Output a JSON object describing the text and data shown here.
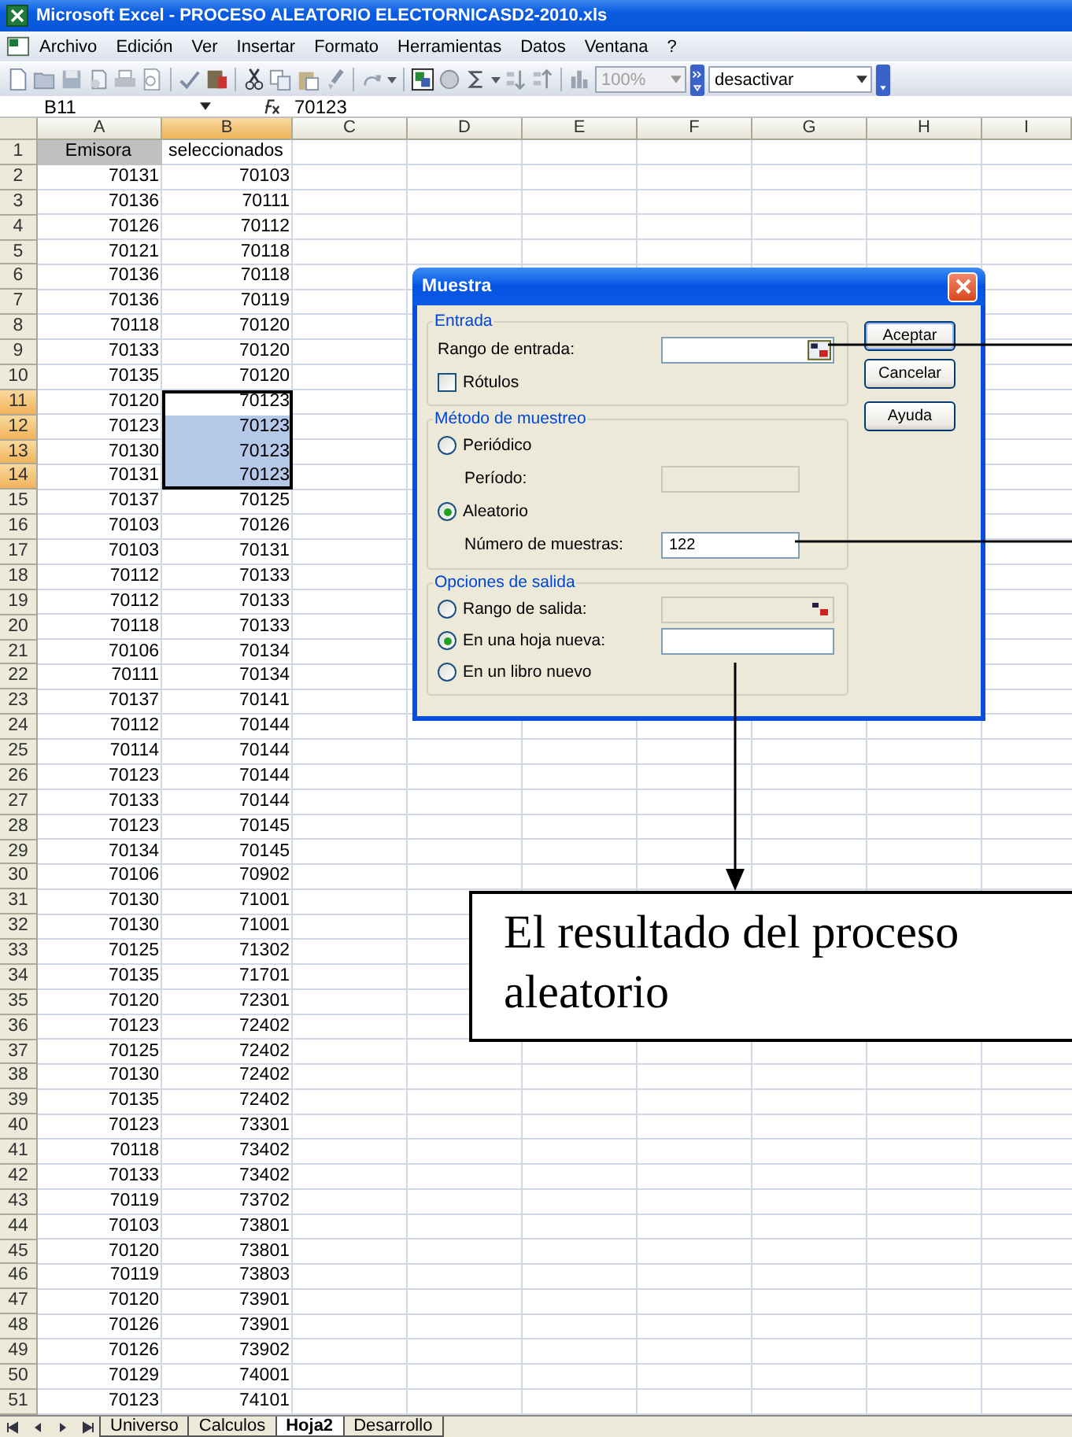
{
  "window": {
    "title": "Microsoft Excel - PROCESO ALEATORIO ELECTORNICASD2-2010.xls"
  },
  "menu_bar": [
    "Archivo",
    "Edición",
    "Ver",
    "Insertar",
    "Formato",
    "Herramientas",
    "Datos",
    "Ventana",
    "?"
  ],
  "toolbar": {
    "zoom": "100%",
    "style": "desactivar"
  },
  "formula_bar": {
    "name_box": "B11",
    "value": "70123"
  },
  "columns": [
    {
      "label": "A",
      "selected": false
    },
    {
      "label": "B",
      "selected": true
    },
    {
      "label": "C",
      "selected": false
    },
    {
      "label": "D",
      "selected": false
    },
    {
      "label": "E",
      "selected": false
    },
    {
      "label": "F",
      "selected": false
    },
    {
      "label": "G",
      "selected": false
    },
    {
      "label": "H",
      "selected": false
    },
    {
      "label": "I",
      "selected": false
    }
  ],
  "rows": [
    {
      "number": "1",
      "kind": "header",
      "selected": false,
      "active": false,
      "cells": [
        "Emisora",
        "seleccionados"
      ]
    },
    {
      "number": "2",
      "kind": "data",
      "selected": false,
      "active": false,
      "cells": [
        "70131",
        "70103"
      ]
    },
    {
      "number": "3",
      "kind": "data",
      "selected": false,
      "active": false,
      "cells": [
        "70136",
        "70111"
      ]
    },
    {
      "number": "4",
      "kind": "data",
      "selected": false,
      "active": false,
      "cells": [
        "70126",
        "70112"
      ]
    },
    {
      "number": "5",
      "kind": "data",
      "selected": false,
      "active": false,
      "cells": [
        "70121",
        "70118"
      ]
    },
    {
      "number": "6",
      "kind": "data",
      "selected": false,
      "active": false,
      "cells": [
        "70136",
        "70118"
      ]
    },
    {
      "number": "7",
      "kind": "data",
      "selected": false,
      "active": false,
      "cells": [
        "70136",
        "70119"
      ]
    },
    {
      "number": "8",
      "kind": "data",
      "selected": false,
      "active": false,
      "cells": [
        "70118",
        "70120"
      ]
    },
    {
      "number": "9",
      "kind": "data",
      "selected": false,
      "active": false,
      "cells": [
        "70133",
        "70120"
      ]
    },
    {
      "number": "10",
      "kind": "data",
      "selected": false,
      "active": false,
      "cells": [
        "70135",
        "70120"
      ]
    },
    {
      "number": "11",
      "kind": "data",
      "selected": true,
      "active": true,
      "cells": [
        "70120",
        "70123"
      ]
    },
    {
      "number": "12",
      "kind": "data",
      "selected": true,
      "active": false,
      "cells": [
        "70123",
        "70123"
      ]
    },
    {
      "number": "13",
      "kind": "data",
      "selected": true,
      "active": false,
      "cells": [
        "70130",
        "70123"
      ]
    },
    {
      "number": "14",
      "kind": "data",
      "selected": true,
      "active": false,
      "cells": [
        "70131",
        "70123"
      ]
    },
    {
      "number": "15",
      "kind": "data",
      "selected": false,
      "active": false,
      "cells": [
        "70137",
        "70125"
      ]
    },
    {
      "number": "16",
      "kind": "data",
      "selected": false,
      "active": false,
      "cells": [
        "70103",
        "70126"
      ]
    },
    {
      "number": "17",
      "kind": "data",
      "selected": false,
      "active": false,
      "cells": [
        "70103",
        "70131"
      ]
    },
    {
      "number": "18",
      "kind": "data",
      "selected": false,
      "active": false,
      "cells": [
        "70112",
        "70133"
      ]
    },
    {
      "number": "19",
      "kind": "data",
      "selected": false,
      "active": false,
      "cells": [
        "70112",
        "70133"
      ]
    },
    {
      "number": "20",
      "kind": "data",
      "selected": false,
      "active": false,
      "cells": [
        "70118",
        "70133"
      ]
    },
    {
      "number": "21",
      "kind": "data",
      "selected": false,
      "active": false,
      "cells": [
        "70106",
        "70134"
      ]
    },
    {
      "number": "22",
      "kind": "data",
      "selected": false,
      "active": false,
      "cells": [
        "70111",
        "70134"
      ]
    },
    {
      "number": "23",
      "kind": "data",
      "selected": false,
      "active": false,
      "cells": [
        "70137",
        "70141"
      ]
    },
    {
      "number": "24",
      "kind": "data",
      "selected": false,
      "active": false,
      "cells": [
        "70112",
        "70144"
      ]
    },
    {
      "number": "25",
      "kind": "data",
      "selected": false,
      "active": false,
      "cells": [
        "70114",
        "70144"
      ]
    },
    {
      "number": "26",
      "kind": "data",
      "selected": false,
      "active": false,
      "cells": [
        "70123",
        "70144"
      ]
    },
    {
      "number": "27",
      "kind": "data",
      "selected": false,
      "active": false,
      "cells": [
        "70133",
        "70144"
      ]
    },
    {
      "number": "28",
      "kind": "data",
      "selected": false,
      "active": false,
      "cells": [
        "70123",
        "70145"
      ]
    },
    {
      "number": "29",
      "kind": "data",
      "selected": false,
      "active": false,
      "cells": [
        "70134",
        "70145"
      ]
    },
    {
      "number": "30",
      "kind": "data",
      "selected": false,
      "active": false,
      "cells": [
        "70106",
        "70902"
      ]
    },
    {
      "number": "31",
      "kind": "data",
      "selected": false,
      "active": false,
      "cells": [
        "70130",
        "71001"
      ]
    },
    {
      "number": "32",
      "kind": "data",
      "selected": false,
      "active": false,
      "cells": [
        "70130",
        "71001"
      ]
    },
    {
      "number": "33",
      "kind": "data",
      "selected": false,
      "active": false,
      "cells": [
        "70125",
        "71302"
      ]
    },
    {
      "number": "34",
      "kind": "data",
      "selected": false,
      "active": false,
      "cells": [
        "70135",
        "71701"
      ]
    },
    {
      "number": "35",
      "kind": "data",
      "selected": false,
      "active": false,
      "cells": [
        "70120",
        "72301"
      ]
    },
    {
      "number": "36",
      "kind": "data",
      "selected": false,
      "active": false,
      "cells": [
        "70123",
        "72402"
      ]
    },
    {
      "number": "37",
      "kind": "data",
      "selected": false,
      "active": false,
      "cells": [
        "70125",
        "72402"
      ]
    },
    {
      "number": "38",
      "kind": "data",
      "selected": false,
      "active": false,
      "cells": [
        "70130",
        "72402"
      ]
    },
    {
      "number": "39",
      "kind": "data",
      "selected": false,
      "active": false,
      "cells": [
        "70135",
        "72402"
      ]
    },
    {
      "number": "40",
      "kind": "data",
      "selected": false,
      "active": false,
      "cells": [
        "70123",
        "73301"
      ]
    },
    {
      "number": "41",
      "kind": "data",
      "selected": false,
      "active": false,
      "cells": [
        "70118",
        "73402"
      ]
    },
    {
      "number": "42",
      "kind": "data",
      "selected": false,
      "active": false,
      "cells": [
        "70133",
        "73402"
      ]
    },
    {
      "number": "43",
      "kind": "data",
      "selected": false,
      "active": false,
      "cells": [
        "70119",
        "73702"
      ]
    },
    {
      "number": "44",
      "kind": "data",
      "selected": false,
      "active": false,
      "cells": [
        "70103",
        "73801"
      ]
    },
    {
      "number": "45",
      "kind": "data",
      "selected": false,
      "active": false,
      "cells": [
        "70120",
        "73801"
      ]
    },
    {
      "number": "46",
      "kind": "data",
      "selected": false,
      "active": false,
      "cells": [
        "70119",
        "73803"
      ]
    },
    {
      "number": "47",
      "kind": "data",
      "selected": false,
      "active": false,
      "cells": [
        "70120",
        "73901"
      ]
    },
    {
      "number": "48",
      "kind": "data",
      "selected": false,
      "active": false,
      "cells": [
        "70126",
        "73901"
      ]
    },
    {
      "number": "49",
      "kind": "data",
      "selected": false,
      "active": false,
      "cells": [
        "70126",
        "73902"
      ]
    },
    {
      "number": "50",
      "kind": "data",
      "selected": false,
      "active": false,
      "cells": [
        "70129",
        "74001"
      ]
    },
    {
      "number": "51",
      "kind": "data",
      "selected": false,
      "active": false,
      "cells": [
        "70123",
        "74101"
      ]
    }
  ],
  "sheet_tabs": [
    {
      "label": "Universo",
      "selected": false
    },
    {
      "label": "Calculos",
      "selected": false
    },
    {
      "label": "Hoja2",
      "selected": true
    },
    {
      "label": "Desarrollo",
      "selected": false
    }
  ],
  "dialog": {
    "title": "Muestra",
    "input_group": {
      "legend": "Entrada",
      "range_label": "Rango de entrada:",
      "checkbox": {
        "label": "Rótulos",
        "checked": false
      }
    },
    "method_group": {
      "legend": "Método de muestreo",
      "options": [
        {
          "label": "Periódico",
          "selected": false,
          "field_label": "Período:",
          "field_disabled": true
        },
        {
          "label": "Aleatorio",
          "selected": true,
          "field_label": "Número de muestras:",
          "field_value": "122",
          "field_disabled": false
        }
      ]
    },
    "output_group": {
      "legend": "Opciones de salida",
      "options": [
        {
          "label": "Rango de salida:",
          "selected": false,
          "kind": "range",
          "field_disabled": true
        },
        {
          "label": "En una hoja nueva:",
          "selected": true,
          "kind": "text",
          "field_disabled": false
        },
        {
          "label": "En un libro nuevo",
          "selected": false,
          "kind": "plain"
        }
      ]
    },
    "buttons": [
      {
        "label": "Aceptar",
        "default": true
      },
      {
        "label": "Cancelar",
        "default": false
      },
      {
        "label": "Ayuda",
        "default": false
      }
    ]
  },
  "callout": {
    "text": "El resultado del proceso aleatorio"
  }
}
